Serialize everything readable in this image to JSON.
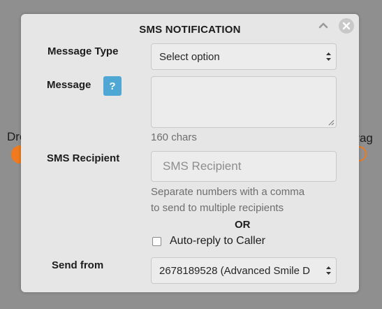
{
  "panel": {
    "title": "SMS NOTIFICATION"
  },
  "message_type": {
    "label": "Message Type",
    "selected": "Select option"
  },
  "message": {
    "label": "Message",
    "help_label": "?",
    "char_count": "160 chars",
    "value": ""
  },
  "recipient": {
    "label": "SMS Recipient",
    "placeholder": "SMS Recipient",
    "hint_line1": "Separate numbers with a comma",
    "hint_line2": "to send to multiple recipients"
  },
  "or_label": "OR",
  "auto_reply": {
    "label": "Auto-reply to Caller",
    "checked": false
  },
  "send_from": {
    "label": "Send from",
    "selected": "2678189528 (Advanced Smile D"
  },
  "connectors": {
    "drop_label": "Drop",
    "drag_label": "Drag"
  },
  "icons": {
    "collapse": "chevron-up-icon",
    "close": "close-circle-icon",
    "select_arrows": "sort-arrows-icon",
    "resize": "resize-grip-icon"
  },
  "colors": {
    "background": "#8f8f8f",
    "panel": "#e6e6e6",
    "accent_orange": "#f07a1c",
    "help_blue": "#4fa8d4"
  }
}
